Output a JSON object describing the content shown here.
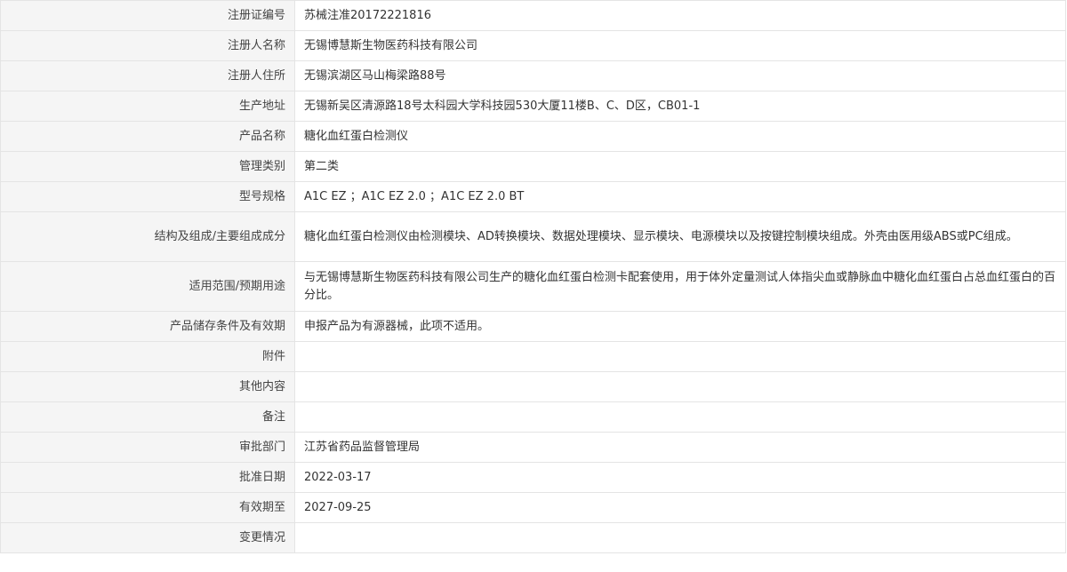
{
  "rows": [
    {
      "label": "注册证编号",
      "value": "苏械注准20172221816"
    },
    {
      "label": "注册人名称",
      "value": "无锡博慧斯生物医药科技有限公司"
    },
    {
      "label": "注册人住所",
      "value": "无锡滨湖区马山梅梁路88号"
    },
    {
      "label": "生产地址",
      "value": "无锡新吴区清源路18号太科园大学科技园530大厦11楼B、C、D区，CB01-1"
    },
    {
      "label": "产品名称",
      "value": "糖化血红蛋白检测仪"
    },
    {
      "label": "管理类别",
      "value": "第二类"
    },
    {
      "label": "型号规格",
      "value": "A1C EZ ；A1C EZ 2.0 ；A1C EZ 2.0 BT"
    },
    {
      "label": "结构及组成/主要组成成分",
      "value": "糖化血红蛋白检测仪由检测模块、AD转换模块、数据处理模块、显示模块、电源模块以及按键控制模块组成。外壳由医用级ABS或PC组成。"
    },
    {
      "label": "适用范围/预期用途",
      "value": "与无锡博慧斯生物医药科技有限公司生产的糖化血红蛋白检测卡配套使用，用于体外定量测试人体指尖血或静脉血中糖化血红蛋白占总血红蛋白的百分比。"
    },
    {
      "label": "产品储存条件及有效期",
      "value": "申报产品为有源器械，此项不适用。"
    },
    {
      "label": "附件",
      "value": ""
    },
    {
      "label": "其他内容",
      "value": ""
    },
    {
      "label": "备注",
      "value": ""
    },
    {
      "label": "审批部门",
      "value": "江苏省药品监督管理局"
    },
    {
      "label": "批准日期",
      "value": "2022-03-17"
    },
    {
      "label": "有效期至",
      "value": "2027-09-25"
    },
    {
      "label": "变更情况",
      "value": ""
    }
  ]
}
